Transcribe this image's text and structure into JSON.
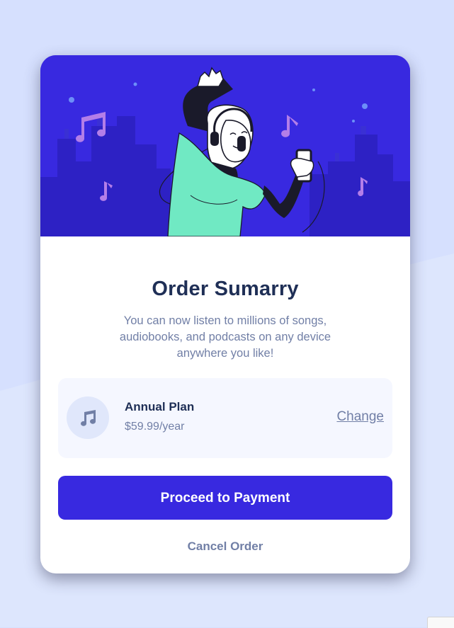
{
  "card": {
    "title": "Order Sumarry",
    "description": "You can now listen to millions of songs, audiobooks, and podcasts on any device anywhere you like!"
  },
  "plan": {
    "icon": "music-note-icon",
    "name": "Annual Plan",
    "price": "$59.99/year",
    "change_label": "Change"
  },
  "actions": {
    "proceed_label": "Proceed to Payment",
    "cancel_label": "Cancel Order"
  },
  "colors": {
    "page_background": "#d6e0fe",
    "accent": "#3829e0",
    "title": "#1f2f56",
    "muted_text": "#717fa6",
    "plan_background": "#f5f7ff"
  }
}
